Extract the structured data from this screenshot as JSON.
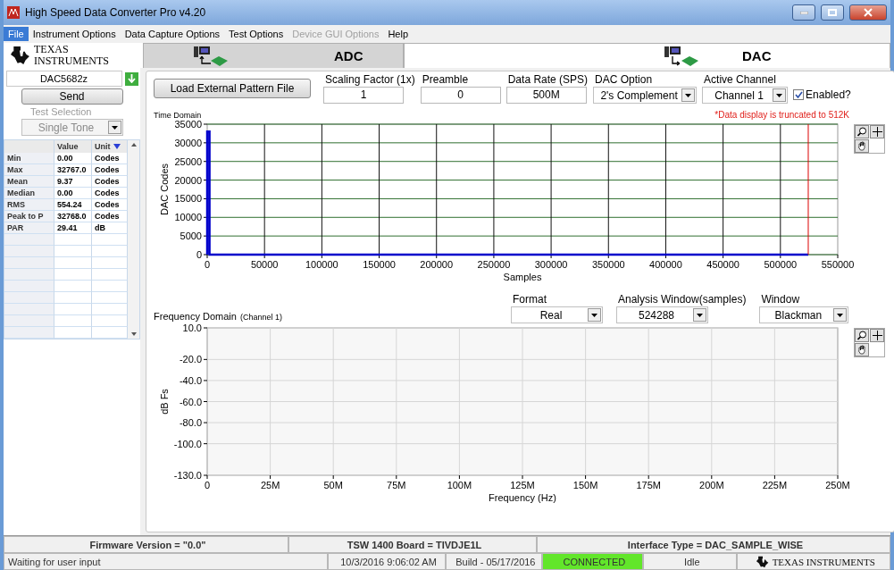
{
  "window": {
    "title": "High Speed Data Converter Pro v4.20"
  },
  "menu": [
    {
      "label": "File",
      "selected": true,
      "disabled": false
    },
    {
      "label": "Instrument Options",
      "selected": false,
      "disabled": false
    },
    {
      "label": "Data Capture Options",
      "selected": false,
      "disabled": false
    },
    {
      "label": "Test Options",
      "selected": false,
      "disabled": false
    },
    {
      "label": "Device GUI Options",
      "selected": false,
      "disabled": true
    },
    {
      "label": "Help",
      "selected": false,
      "disabled": false
    }
  ],
  "logo": {
    "text": "TEXAS INSTRUMENTS"
  },
  "tabs": [
    {
      "label": "ADC",
      "kind": "adc",
      "selected": false
    },
    {
      "label": "DAC",
      "kind": "dac",
      "selected": true
    }
  ],
  "sidebar": {
    "device": "DAC5682z",
    "send": "Send",
    "test_selection": {
      "label": "Test Selection",
      "value": "Single Tone",
      "disabled": true
    },
    "table": {
      "columns": [
        "Value",
        "Unit"
      ],
      "rows": [
        {
          "name": "Min",
          "value": "0.00",
          "unit": "Codes"
        },
        {
          "name": "Max",
          "value": "32767.0",
          "unit": "Codes"
        },
        {
          "name": "Mean",
          "value": "9.37",
          "unit": "Codes"
        },
        {
          "name": "Median",
          "value": "0.00",
          "unit": "Codes"
        },
        {
          "name": "RMS",
          "value": "554.24",
          "unit": "Codes"
        },
        {
          "name": "Peak to P",
          "value": "32768.0",
          "unit": "Codes"
        },
        {
          "name": "PAR",
          "value": "29.41",
          "unit": "dB"
        }
      ]
    }
  },
  "controls": {
    "load_button": "Load External Pattern File",
    "fields": [
      {
        "label": "Scaling Factor (1x)",
        "value": "1",
        "kind": "text"
      },
      {
        "label": "Preamble",
        "value": "0",
        "kind": "text"
      },
      {
        "label": "Data Rate (SPS)",
        "value": "500M",
        "kind": "text"
      },
      {
        "label": "DAC Option",
        "value": "2's Complement",
        "kind": "dropdown"
      },
      {
        "label": "Active Channel",
        "value": "Channel 1",
        "kind": "dropdown"
      }
    ],
    "enabled": {
      "label": "Enabled?",
      "checked": true
    },
    "note": "*Data display is truncated to 512K"
  },
  "time_domain": {
    "title": "Time Domain",
    "chart_data": {
      "type": "line",
      "xlabel": "Samples",
      "ylabel": "DAC Codes",
      "xlim": [
        0,
        550000
      ],
      "ylim": [
        0,
        35000
      ],
      "xticks": [
        0,
        50000,
        100000,
        150000,
        200000,
        250000,
        300000,
        350000,
        400000,
        450000,
        500000,
        550000
      ],
      "yticks": [
        0,
        5000,
        10000,
        15000,
        20000,
        25000,
        30000,
        35000
      ],
      "grid": true,
      "x": [
        0,
        0,
        2000,
        2000,
        524288
      ],
      "series": [
        {
          "color": "#0000cc",
          "values": [
            0,
            33000,
            33000,
            0,
            0
          ]
        }
      ],
      "ref_lines": [
        {
          "axis": "x",
          "value": 524288,
          "color": "#dd0000"
        }
      ]
    }
  },
  "frequency_domain": {
    "title": "Frequency Domain",
    "channel": "(Channel 1)",
    "selectors": [
      {
        "label": "Format",
        "value": "Real"
      },
      {
        "label": "Analysis Window(samples)",
        "value": "524288"
      },
      {
        "label": "Window",
        "value": "Blackman"
      }
    ],
    "chart_data": {
      "type": "line",
      "xlabel": "Frequency (Hz)",
      "ylabel": "dB Fs",
      "xlim": [
        0,
        250000000
      ],
      "ylim": [
        -130,
        10
      ],
      "grid": true,
      "xticks": [
        {
          "value": 0,
          "label": "0"
        },
        {
          "value": 25000000,
          "label": "25M"
        },
        {
          "value": 50000000,
          "label": "50M"
        },
        {
          "value": 75000000,
          "label": "75M"
        },
        {
          "value": 100000000,
          "label": "100M"
        },
        {
          "value": 125000000,
          "label": "125M"
        },
        {
          "value": 150000000,
          "label": "150M"
        },
        {
          "value": 175000000,
          "label": "175M"
        },
        {
          "value": 200000000,
          "label": "200M"
        },
        {
          "value": 225000000,
          "label": "225M"
        },
        {
          "value": 250000000,
          "label": "250M"
        }
      ],
      "yticks": [
        {
          "value": 10,
          "label": "10.0"
        },
        {
          "value": -20,
          "label": "-20.0"
        },
        {
          "value": -40,
          "label": "-40.0"
        },
        {
          "value": -60,
          "label": "-60.0"
        },
        {
          "value": -80,
          "label": "-80.0"
        },
        {
          "value": -100,
          "label": "-100.0"
        },
        {
          "value": -130,
          "label": "-130.0"
        }
      ]
    }
  },
  "status_bar": {
    "info": [
      "Firmware Version = \"0.0\"",
      "TSW 1400 Board = TIVDJE1L",
      "Interface Type = DAC_SAMPLE_WISE"
    ],
    "message": "Waiting for user input",
    "time": "10/3/2016 9:06:02 AM",
    "build": "Build - 05/17/2016",
    "connection": {
      "text": "CONNECTED",
      "connected": true
    },
    "state": "Idle",
    "logo": "TEXAS INSTRUMENTS"
  }
}
